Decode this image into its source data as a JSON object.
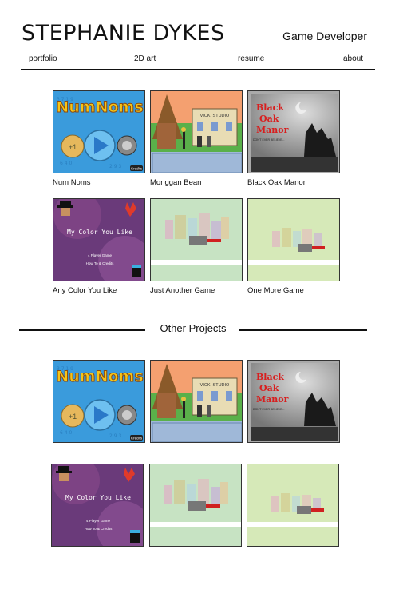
{
  "header": {
    "name": "STEPHANIE DYKES",
    "role": "Game Developer"
  },
  "nav": {
    "items": [
      "portfolio",
      "2D art",
      "resume",
      "about"
    ],
    "active": "portfolio"
  },
  "portfolio": {
    "items": [
      {
        "title": "Num Noms",
        "art_text": "NumNoms",
        "badge": "Credits"
      },
      {
        "title": "Moriggan Bean",
        "art_text": "VICKI STUDIO"
      },
      {
        "title": "Black Oak Manor",
        "art_text": [
          "Black",
          "Oak",
          "Manor"
        ],
        "art_subtext": "DON'T EVER BELIEVE..."
      },
      {
        "title": "Any Color You Like",
        "art_text": "My Color You Like",
        "art_menu": [
          "4 Player Game",
          "How To & Credits"
        ]
      },
      {
        "title": "Just Another Game"
      },
      {
        "title": "One More Game"
      }
    ]
  },
  "other_projects": {
    "heading": "Other Projects",
    "items": [
      {
        "art_text": "NumNoms",
        "badge": "Credits"
      },
      {
        "art_text": "VICKI STUDIO"
      },
      {
        "art_text": [
          "Black",
          "Oak",
          "Manor"
        ],
        "art_subtext": "DON'T EVER BELIEVE..."
      },
      {
        "art_text": "My Color You Like",
        "art_menu": [
          "4 Player Game",
          "How To & Credits"
        ]
      },
      {},
      {}
    ]
  },
  "colors": {
    "numnoms_bg": "#3a9bdc",
    "numnoms_title": "#f5c518",
    "manor_bg": "#8a8a8a",
    "manor_title": "#d81e1e",
    "color_bg": "#6a3a7a",
    "pale_green": "#c7e3c3",
    "pale_lime": "#d6e9b8"
  }
}
